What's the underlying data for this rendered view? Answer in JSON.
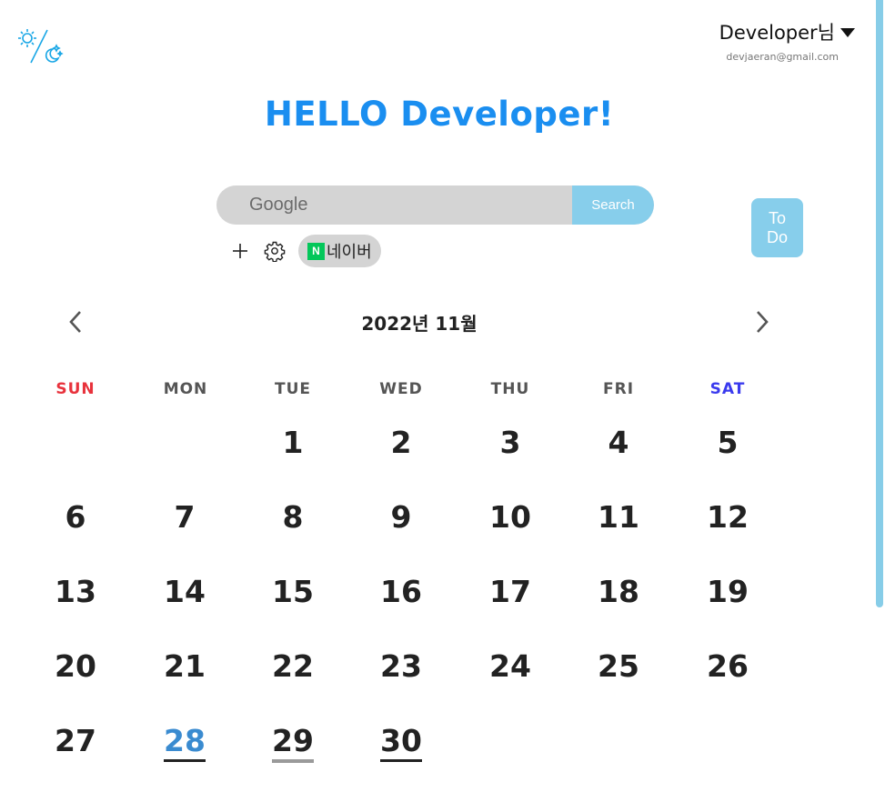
{
  "header": {
    "logo_icon": "sun-moon-toggle-icon",
    "user_name": "Developer님",
    "user_email": "devjaeran@gmail.com"
  },
  "greeting": "HELLO Developer!",
  "search": {
    "placeholder": "Google",
    "button_label": "Search"
  },
  "shortcuts": {
    "add_icon": "plus-icon",
    "settings_icon": "gear-icon",
    "bookmarks": [
      {
        "icon": "naver-icon",
        "icon_letter": "N",
        "label": "네이버"
      }
    ]
  },
  "todo": {
    "label_line1": "To",
    "label_line2": "Do"
  },
  "calendar": {
    "title": "2022년 11월",
    "prev_icon": "chevron-left-icon",
    "next_icon": "chevron-right-icon",
    "weekdays": [
      "SUN",
      "MON",
      "TUE",
      "WED",
      "THU",
      "FRI",
      "SAT"
    ],
    "weeks": [
      [
        "",
        "",
        "1",
        "2",
        "3",
        "4",
        "5"
      ],
      [
        "6",
        "7",
        "8",
        "9",
        "10",
        "11",
        "12"
      ],
      [
        "13",
        "14",
        "15",
        "16",
        "17",
        "18",
        "19"
      ],
      [
        "20",
        "21",
        "22",
        "23",
        "24",
        "25",
        "26"
      ],
      [
        "27",
        "28",
        "29",
        "30",
        "",
        "",
        ""
      ]
    ],
    "today": "28",
    "colors": {
      "sunday": "#e8323c",
      "saturday": "#3a3aee",
      "today": "#3a8bd0",
      "greeting": "#1a8ef0",
      "accent": "#87ceeb"
    }
  }
}
